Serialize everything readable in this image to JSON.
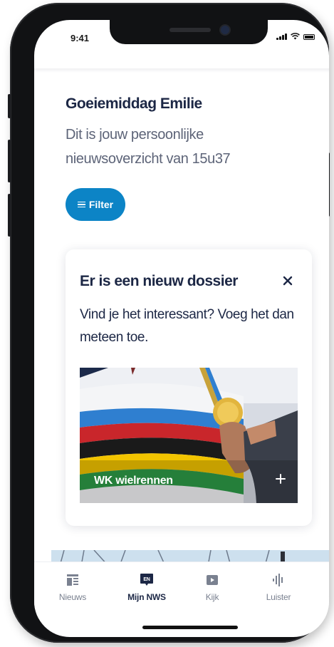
{
  "status_bar": {
    "time": "9:41"
  },
  "greeting": {
    "title": "Goeiemiddag Emilie",
    "subtitle": "Dit is jouw persoonlijke nieuwsoverzicht van 15u37"
  },
  "filter": {
    "label": "Filter",
    "icon": "sliders-icon"
  },
  "dossier_card": {
    "title": "Er is een nieuw dossier",
    "body": "Vind je het interessant? Voeg het dan meteen toe.",
    "image_label": "WK wielrennen",
    "close_icon": "close-icon",
    "add_icon": "plus-icon"
  },
  "tabs": [
    {
      "label": "Nieuws",
      "icon": "news-icon",
      "active": false
    },
    {
      "label": "Mijn NWS",
      "icon": "mijn-nws-badge-icon",
      "badge": "EN",
      "active": true
    },
    {
      "label": "Kijk",
      "icon": "play-icon",
      "active": false
    },
    {
      "label": "Luister",
      "icon": "audio-wave-icon",
      "active": false
    }
  ],
  "colors": {
    "accent": "#0c84c6",
    "heading": "#1c2745",
    "muted": "#5d6478"
  }
}
